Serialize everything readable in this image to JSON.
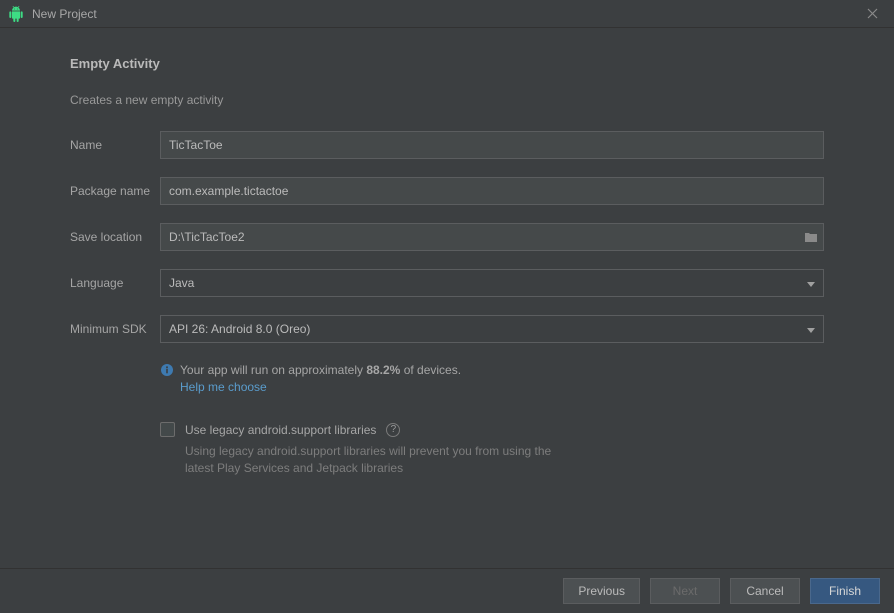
{
  "window": {
    "title": "New Project"
  },
  "page": {
    "heading": "Empty Activity",
    "subtext": "Creates a new empty activity"
  },
  "form": {
    "name": {
      "label": "Name",
      "value": "TicTacToe"
    },
    "package": {
      "label": "Package name",
      "value": "com.example.tictactoe"
    },
    "location": {
      "label": "Save location",
      "value": "D:\\TicTacToe2"
    },
    "language": {
      "label": "Language",
      "value": "Java"
    },
    "minsdk": {
      "label": "Minimum SDK",
      "value": "API 26: Android 8.0 (Oreo)"
    },
    "info": {
      "pre": "Your app will run on approximately ",
      "pct": "88.2%",
      "post": " of devices.",
      "help": "Help me choose"
    },
    "legacy": {
      "label": "Use legacy android.support libraries",
      "desc": "Using legacy android.support libraries will prevent you from using the latest Play Services and Jetpack libraries"
    }
  },
  "buttons": {
    "previous": "Previous",
    "next": "Next",
    "cancel": "Cancel",
    "finish": "Finish"
  }
}
